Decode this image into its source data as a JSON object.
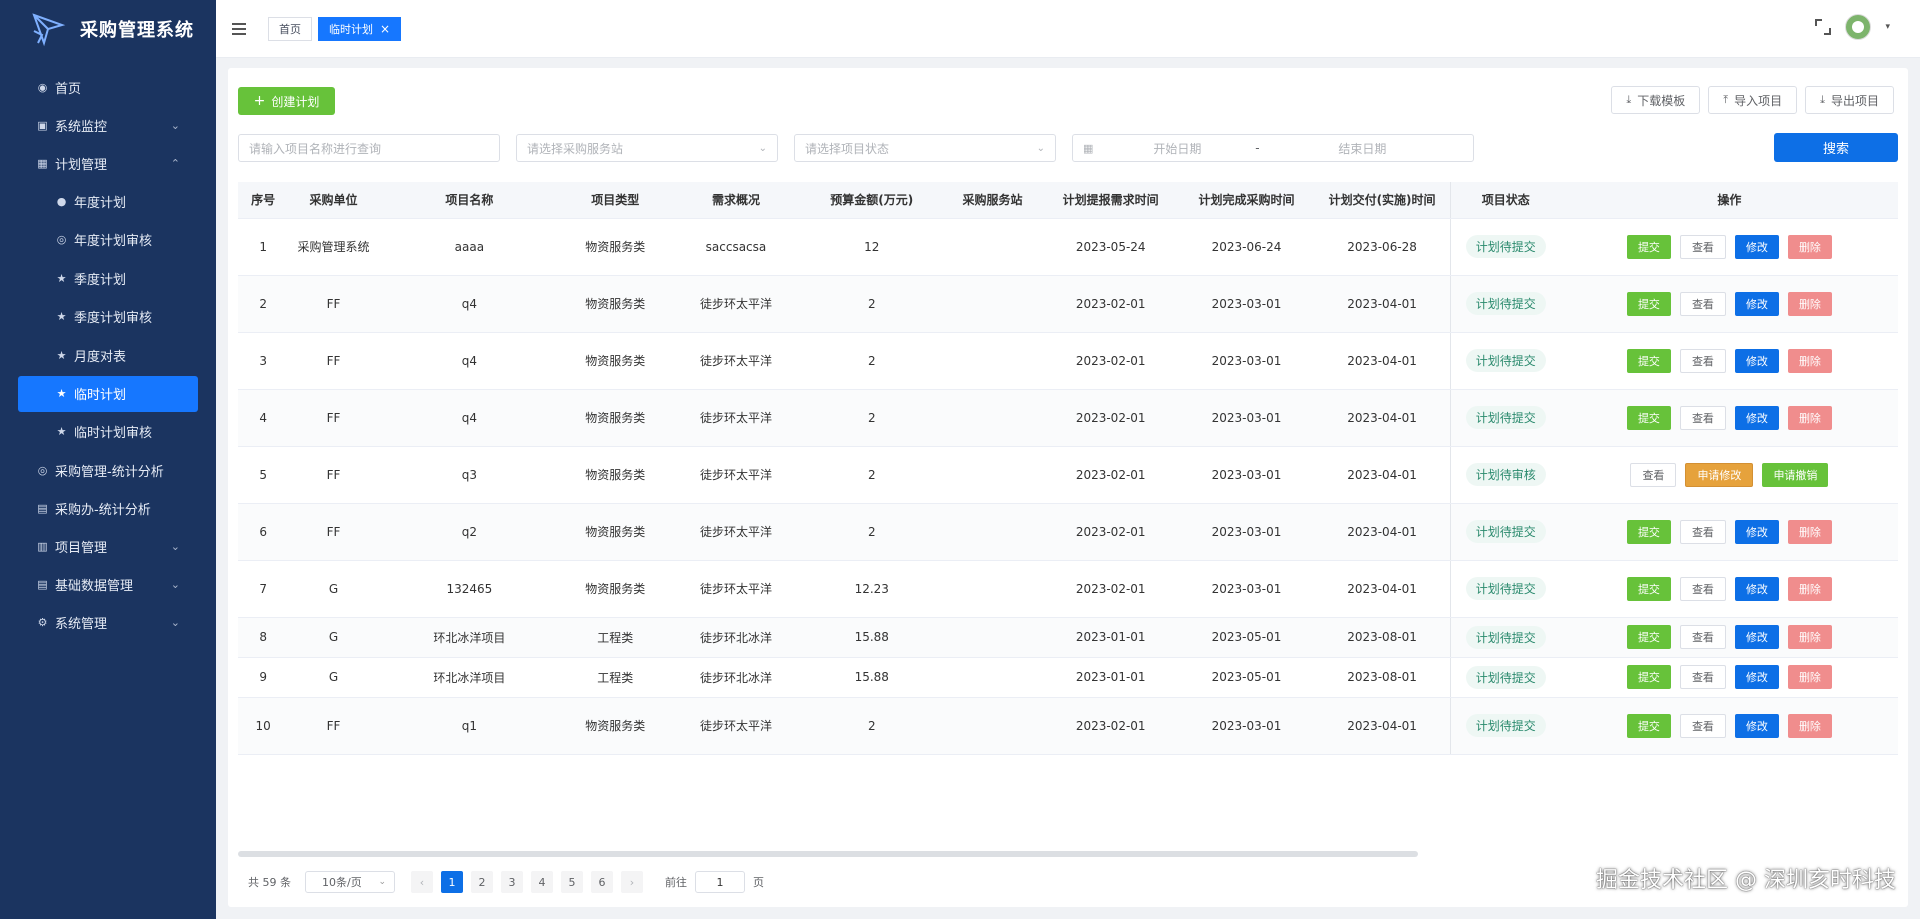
{
  "app": {
    "title": "采购管理系统"
  },
  "sidebar": {
    "items": [
      {
        "label": "首页",
        "icon": "dashboard-icon"
      },
      {
        "label": "系统监控",
        "icon": "monitor-icon",
        "expandable": true
      },
      {
        "label": "计划管理",
        "icon": "calendar-icon",
        "expandable": true,
        "expanded": true
      },
      {
        "label": "采购管理-统计分析",
        "icon": "chart-icon"
      },
      {
        "label": "采购办-统计分析",
        "icon": "chart-icon"
      },
      {
        "label": "项目管理",
        "icon": "folder-icon",
        "expandable": true
      },
      {
        "label": "基础数据管理",
        "icon": "database-icon",
        "expandable": true
      },
      {
        "label": "系统管理",
        "icon": "gear-icon",
        "expandable": true
      }
    ],
    "sub_items": [
      {
        "label": "年度计划"
      },
      {
        "label": "年度计划审核"
      },
      {
        "label": "季度计划"
      },
      {
        "label": "季度计划审核"
      },
      {
        "label": "月度对表"
      },
      {
        "label": "临时计划",
        "active": true
      },
      {
        "label": "临时计划审核"
      }
    ]
  },
  "topbar": {
    "tabs": [
      {
        "label": "首页"
      },
      {
        "label": "临时计划",
        "active": true,
        "close": "×"
      }
    ]
  },
  "toolbar": {
    "create_label": "创建计划",
    "download_template": "下载模板",
    "import_project": "导入项目",
    "export_project": "导出项目"
  },
  "filters": {
    "name_placeholder": "请输入项目名称进行查询",
    "station_placeholder": "请选择采购服务站",
    "status_placeholder": "请选择项目状态",
    "start_date_placeholder": "开始日期",
    "date_separator": "-",
    "end_date_placeholder": "结束日期",
    "search_label": "搜索"
  },
  "table": {
    "headers": [
      "序号",
      "采购单位",
      "项目名称",
      "项目类型",
      "需求概况",
      "预算金额(万元)",
      "采购服务站",
      "计划提报需求时间",
      "计划完成采购时间",
      "计划交付(实施)时间",
      "项目状态",
      "操作"
    ],
    "op_labels": {
      "submit": "提交",
      "view": "查看",
      "edit": "修改",
      "delete": "删除",
      "apply_edit": "申请修改",
      "apply_cancel": "申请撤销"
    },
    "rows": [
      {
        "no": "1",
        "unit": "采购管理系统",
        "name": "aaaa",
        "type": "物资服务类",
        "summary": "saccsacsa",
        "budget": "12",
        "station": "",
        "report_date": "2023-05-24",
        "purchase_date": "2023-06-24",
        "delivery_date": "2023-06-28",
        "status": "计划待提交",
        "ops": "normal"
      },
      {
        "no": "2",
        "unit": "FF",
        "name": "q4",
        "type": "物资服务类",
        "summary": "徒步环太平洋",
        "budget": "2",
        "station": "",
        "report_date": "2023-02-01",
        "purchase_date": "2023-03-01",
        "delivery_date": "2023-04-01",
        "status": "计划待提交",
        "ops": "normal"
      },
      {
        "no": "3",
        "unit": "FF",
        "name": "q4",
        "type": "物资服务类",
        "summary": "徒步环太平洋",
        "budget": "2",
        "station": "",
        "report_date": "2023-02-01",
        "purchase_date": "2023-03-01",
        "delivery_date": "2023-04-01",
        "status": "计划待提交",
        "ops": "normal"
      },
      {
        "no": "4",
        "unit": "FF",
        "name": "q4",
        "type": "物资服务类",
        "summary": "徒步环太平洋",
        "budget": "2",
        "station": "",
        "report_date": "2023-02-01",
        "purchase_date": "2023-03-01",
        "delivery_date": "2023-04-01",
        "status": "计划待提交",
        "ops": "normal"
      },
      {
        "no": "5",
        "unit": "FF",
        "name": "q3",
        "type": "物资服务类",
        "summary": "徒步环太平洋",
        "budget": "2",
        "station": "",
        "report_date": "2023-02-01",
        "purchase_date": "2023-03-01",
        "delivery_date": "2023-04-01",
        "status": "计划待审核",
        "ops": "review"
      },
      {
        "no": "6",
        "unit": "FF",
        "name": "q2",
        "type": "物资服务类",
        "summary": "徒步环太平洋",
        "budget": "2",
        "station": "",
        "report_date": "2023-02-01",
        "purchase_date": "2023-03-01",
        "delivery_date": "2023-04-01",
        "status": "计划待提交",
        "ops": "normal"
      },
      {
        "no": "7",
        "unit": "G",
        "name": "132465",
        "type": "物资服务类",
        "summary": "徒步环太平洋",
        "budget": "12.23",
        "station": "",
        "report_date": "2023-02-01",
        "purchase_date": "2023-03-01",
        "delivery_date": "2023-04-01",
        "status": "计划待提交",
        "ops": "normal"
      },
      {
        "no": "8",
        "unit": "G",
        "name": "环北冰洋项目",
        "type": "工程类",
        "summary": "徒步环北冰洋",
        "budget": "15.88",
        "station": "",
        "report_date": "2023-01-01",
        "purchase_date": "2023-05-01",
        "delivery_date": "2023-08-01",
        "status": "计划待提交",
        "ops": "normal"
      },
      {
        "no": "9",
        "unit": "G",
        "name": "环北冰洋项目",
        "type": "工程类",
        "summary": "徒步环北冰洋",
        "budget": "15.88",
        "station": "",
        "report_date": "2023-01-01",
        "purchase_date": "2023-05-01",
        "delivery_date": "2023-08-01",
        "status": "计划待提交",
        "ops": "normal"
      },
      {
        "no": "10",
        "unit": "FF",
        "name": "q1",
        "type": "物资服务类",
        "summary": "徒步环太平洋",
        "budget": "2",
        "station": "",
        "report_date": "2023-02-01",
        "purchase_date": "2023-03-01",
        "delivery_date": "2023-04-01",
        "status": "计划待提交",
        "ops": "normal"
      }
    ]
  },
  "pagination": {
    "total": "共 59 条",
    "page_size": "10条/页",
    "pages": [
      "1",
      "2",
      "3",
      "4",
      "5",
      "6"
    ],
    "current": "1",
    "prev": "‹",
    "next": "›",
    "goto_label": "前往",
    "goto_value": "1",
    "page_suffix": "页"
  },
  "watermark": "掘金技术社区 @ 深圳亥时科技"
}
